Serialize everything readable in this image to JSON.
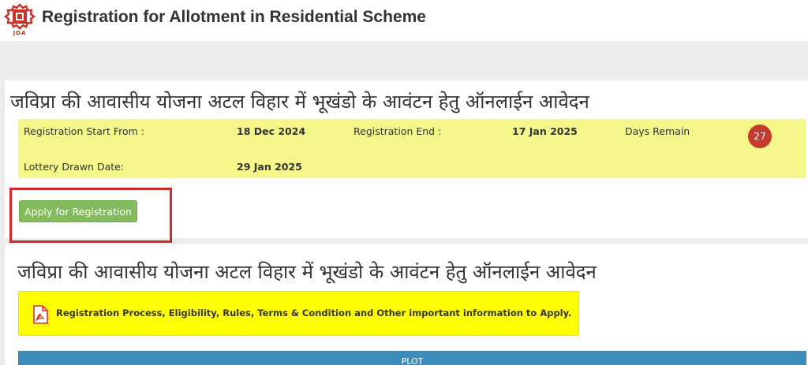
{
  "header": {
    "logo_text": "JDA",
    "title": "Registration for Allotment in Residential Scheme"
  },
  "scheme": {
    "heading": "जविप्रा की आवासीय योजना अटल विहार में भूखंडो के आवंटन हेतु ऑनलाईन आवेदन",
    "registration_start_label": "Registration Start From :",
    "registration_start_value": "18 Dec 2024",
    "registration_end_label": "Registration End :",
    "registration_end_value": "17 Jan 2025",
    "days_remain_label": "Days Remain",
    "days_remain_value": "27",
    "lottery_label": "Lottery Drawn Date:",
    "lottery_value": "29 Jan 2025",
    "apply_label": "Apply for Registration"
  },
  "details": {
    "heading": "जविप्रा की आवासीय योजना अटल विहार में भूखंडो के आवंटन हेतु ऑनलाईन आवेदन",
    "notice_text": "Registration Process, Eligibility, Rules, Terms & Condition and Other important information to Apply.",
    "plot_tab_label": "PLOT"
  },
  "colors": {
    "info_box": "#f5f78a",
    "days_badge": "#c33a2f",
    "apply_button": "#82bb5b",
    "highlight_frame": "#d02a2a",
    "notice_box": "#ffff00",
    "plot_bar": "#3c8dbc"
  },
  "icons": {
    "logo": "jda-logo-icon",
    "notice": "pdf-icon"
  }
}
